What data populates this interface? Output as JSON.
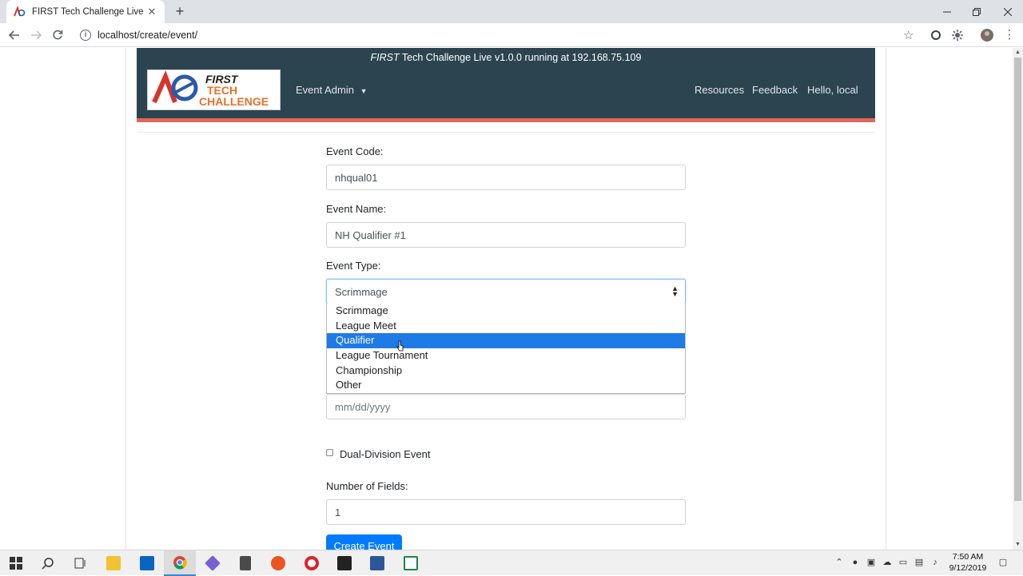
{
  "browser": {
    "tab_title": "FIRST Tech Challenge Live",
    "url": "localhost/create/event/"
  },
  "header": {
    "running_prefix": "FIRST",
    "running_text": " Tech Challenge Live v1.0.0 running at 192.168.75.109",
    "logo_first": "FIRST",
    "logo_tech": "TECH",
    "logo_challenge": "CHALLENGE",
    "event_admin": "Event Admin",
    "resources": "Resources",
    "feedback": "Feedback",
    "hello": "Hello, local"
  },
  "form": {
    "event_code_label": "Event Code:",
    "event_code_value": "nhqual01",
    "event_name_label": "Event Name:",
    "event_name_value": "NH Qualifier #1",
    "event_type_label": "Event Type:",
    "event_type_value": "Scrimmage",
    "event_type_options": [
      "Scrimmage",
      "League Meet",
      "Qualifier",
      "League Tournament",
      "Championship",
      "Other"
    ],
    "event_type_highlighted": "Qualifier",
    "date_placeholder": "mm/dd/yyyy",
    "dual_division_label": "Dual-Division Event",
    "dual_division_checked": false,
    "num_fields_label": "Number of Fields:",
    "num_fields_value": "1",
    "create_button": "Create Event"
  },
  "taskbar": {
    "time": "7:50 AM",
    "date": "9/12/2019"
  },
  "colors": {
    "header_bg": "#2b4450",
    "header_accent": "#e06757",
    "primary": "#007bff",
    "highlight": "#1e7ae6"
  }
}
